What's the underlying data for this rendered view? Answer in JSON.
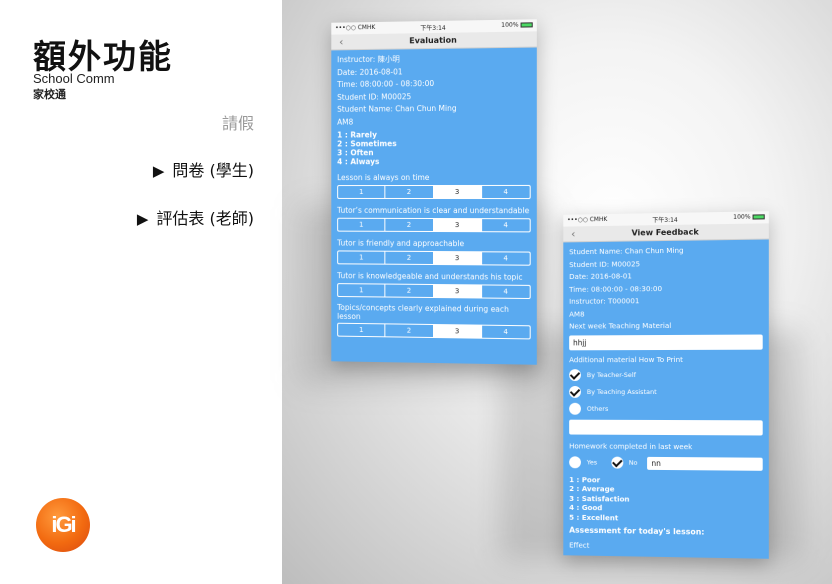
{
  "slide": {
    "title": "額外功能",
    "subtitle_en": "School Comm",
    "subtitle_zh": "家校通",
    "menu": [
      {
        "label": "請假"
      },
      {
        "arrow": "▶",
        "label": "問卷 (學生)"
      },
      {
        "arrow": "▶",
        "label": "評估表 (老師)"
      }
    ],
    "logo_text": "iGi"
  },
  "colors": {
    "accent": "#5aaaf0",
    "logo": "#f26a10"
  },
  "phone1": {
    "status": {
      "carrier": "•••○○ CMHK",
      "time": "下午3:14",
      "battery": "100%"
    },
    "nav": {
      "back": "‹",
      "title": "Evaluation"
    },
    "info": [
      "Instructor: 陳小明",
      "Date: 2016-08-01",
      "Time: 08:00:00 - 08:30:00",
      "Student ID: M00025",
      "Student Name: Chan Chun Ming",
      "AM8"
    ],
    "scale": [
      "1 : Rarely",
      "2 : Sometimes",
      "3 : Often",
      "4 : Always"
    ],
    "questions": [
      {
        "text": "Lesson is always on time",
        "options": [
          "1",
          "2",
          "3",
          "4"
        ],
        "selected": 3
      },
      {
        "text": "Tutor’s communication is clear and understandable",
        "options": [
          "1",
          "2",
          "3",
          "4"
        ],
        "selected": 3
      },
      {
        "text": "Tutor is friendly and approachable",
        "options": [
          "1",
          "2",
          "3",
          "4"
        ],
        "selected": 3
      },
      {
        "text": "Tutor is knowledgeable and understands his topic",
        "options": [
          "1",
          "2",
          "3",
          "4"
        ],
        "selected": 3
      },
      {
        "text": "Topics/concepts clearly explained during each lesson",
        "options": [
          "1",
          "2",
          "3",
          "4"
        ],
        "selected": 3
      }
    ]
  },
  "phone2": {
    "status": {
      "carrier": "•••○○ CMHK",
      "time": "下午3:14",
      "battery": "100%"
    },
    "nav": {
      "back": "‹",
      "title": "View Feedback"
    },
    "info": [
      "Student Name: Chan Chun Ming",
      "Student ID: M00025",
      "Date: 2016-08-01",
      "Time: 08:00:00 - 08:30:00",
      "Instructor: T000001",
      "AM8",
      "Next week Teaching Material"
    ],
    "material_value": "hhjj",
    "print_label": "Additional material How To Print",
    "print_options": [
      {
        "label": "By Teacher-Self",
        "checked": true
      },
      {
        "label": "By Teaching Assistant",
        "checked": true
      },
      {
        "label": "Others",
        "checked": false
      }
    ],
    "others_value": "",
    "homework_label": "Homework completed in last week",
    "homework_yes": "Yes",
    "homework_no": "No",
    "homework_value": "nn",
    "scale": [
      "1 : Poor",
      "2 : Average",
      "3 : Satisfaction",
      "4 : Good",
      "5 : Excellent"
    ],
    "assessment_label": "Assessment for today's lesson:",
    "effect_label": "Effect"
  }
}
